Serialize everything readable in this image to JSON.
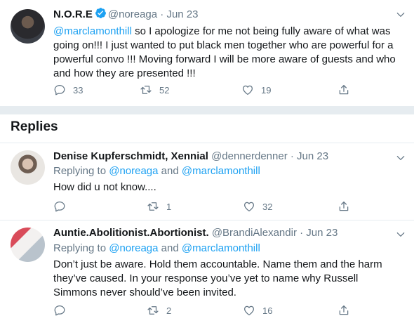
{
  "tweet": {
    "name": "N.O.R.E",
    "handle": "@noreaga",
    "dot": "·",
    "date": "Jun 23",
    "mention": "@marclamonthill",
    "text": " so I apologize for me not being fully aware of what was going on!!! I just wanted to put black men together who are powerful for a powerful convo !!! Moving forward I will be more aware of guests and who and how they are presented !!!",
    "replies": "33",
    "retweets": "52",
    "likes": "19"
  },
  "section": {
    "title": "Replies"
  },
  "replies": [
    {
      "name": "Denise Kupferschmidt, Xennial",
      "handle": "@dennerdenner",
      "dot": "·",
      "date": "Jun 23",
      "replying_prefix": "Replying to ",
      "replying_to_1": "@noreaga",
      "replying_and": " and ",
      "replying_to_2": "@marclamonthill",
      "text": "How did u not know....",
      "replies": "",
      "retweets": "1",
      "likes": "32"
    },
    {
      "name": "Auntie.Abolitionist.Abortionist.",
      "handle": "@BrandiAlexandir",
      "dot": "·",
      "date": "Jun 23",
      "replying_prefix": "Replying to ",
      "replying_to_1": "@noreaga",
      "replying_and": " and ",
      "replying_to_2": "@marclamonthill",
      "text": "Don’t just be aware. Hold them accountable. Name them and the harm they’ve caused. In your response you’ve yet to name why Russell Simmons never should’ve been invited.",
      "replies": "",
      "retweets": "2",
      "likes": "16"
    }
  ],
  "colors": {
    "link": "#1da1f2",
    "muted": "#657786",
    "text": "#14171a",
    "separator": "#e6ecf0"
  },
  "icons": [
    "verified-badge-icon",
    "chevron-down-icon",
    "reply-icon",
    "retweet-icon",
    "like-icon",
    "share-icon"
  ]
}
